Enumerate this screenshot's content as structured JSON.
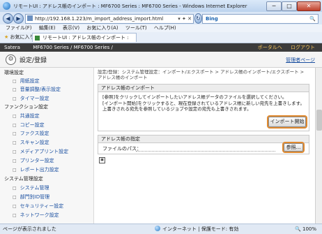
{
  "window": {
    "title": "リモートUI : アドレス帳のインポート : MF6700 Series : MF6700 Series - Windows Internet Explorer",
    "min": "─",
    "max": "□",
    "close": "✕"
  },
  "address_bar": {
    "back": "◀",
    "forward": "▶",
    "url": "http://192.168.1.223/m_import_address_import.html",
    "refresh": "↻",
    "stop": "✕",
    "go_icons": "▾ ✦ ✕",
    "search_engine": "Bing",
    "search_icon": "🔍"
  },
  "menu": [
    "ファイル(F)",
    "編集(E)",
    "表示(V)",
    "お気に入り(A)",
    "ツール(T)",
    "ヘルプ(H)"
  ],
  "favorites": {
    "label": "お気に入り",
    "tab_title": "リモートUI : アドレス帳のインポート : MF67..."
  },
  "banner": {
    "brand": "Satera",
    "model": "MF6700 Series / MF6700 Series /",
    "portal": "ポータルへ",
    "logout": "ログアウト"
  },
  "header": {
    "title": "設定/登録",
    "manager": "管理者ページ"
  },
  "sidebar": [
    {
      "type": "heading",
      "label": "環境設定"
    },
    {
      "type": "item",
      "label": "用紙設定"
    },
    {
      "type": "item",
      "label": "音量調整/表示設定"
    },
    {
      "type": "item",
      "label": "タイマー設定"
    },
    {
      "type": "heading",
      "label": "ファンクション設定"
    },
    {
      "type": "item",
      "label": "共通設定"
    },
    {
      "type": "item",
      "label": "コピー設定"
    },
    {
      "type": "item",
      "label": "ファクス設定"
    },
    {
      "type": "item",
      "label": "スキャン設定"
    },
    {
      "type": "item",
      "label": "メディアプリント設定"
    },
    {
      "type": "item",
      "label": "プリンター設定"
    },
    {
      "type": "item",
      "label": "レポート出力設定"
    },
    {
      "type": "heading",
      "label": "システム管理設定"
    },
    {
      "type": "item",
      "label": "システム管理"
    },
    {
      "type": "item",
      "label": "部門別ID管理"
    },
    {
      "type": "item",
      "label": "セキュリティー設定"
    },
    {
      "type": "item",
      "label": "ネットワーク設定"
    }
  ],
  "main": {
    "breadcrumb": "設定/登録：システム管理設定：インポート/エクスポート > アドレス帳のインポート/エクスポート > アドレス帳のインポート",
    "import_section": {
      "title": "アドレス帳のインポート",
      "line1": "[参照]をクリックしてインポートしたいアドレス帳データのファイルを選択してください。",
      "line2": "[インポート開始]をクリックすると、現在登録されているアドレス帳に新しい宛先を上書きします。",
      "line3": "上書きされる宛先を参照しているジョブや設定の宛先も上書きされます。",
      "start_button": "インポート開始"
    },
    "file_section": {
      "title": "アドレス帳の指定",
      "path_label": "ファイルのパス：",
      "browse_button": "参照..."
    }
  },
  "status": {
    "left": "ページが表示されました",
    "zone": "インターネット | 保護モード: 有効",
    "zoom": "🔍 100%"
  }
}
